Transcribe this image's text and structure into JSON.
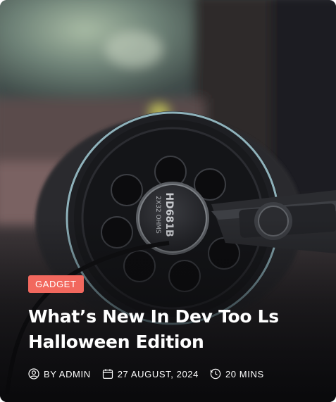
{
  "post": {
    "category": "GADGET",
    "title": "What’s New In Dev Too Ls Halloween Edition",
    "author": "BY ADMIN",
    "date": "27 AUGUST, 2024",
    "read_time": "20 MINS"
  },
  "image": {
    "subject": "over-ear studio headphones",
    "printed_text": [
      "HD681B",
      "2X32 OHMS"
    ]
  },
  "icons": {
    "author": "user-circle-icon",
    "date": "calendar-icon",
    "read_time": "clock-icon"
  },
  "colors": {
    "badge": "#f2685e",
    "text": "#ffffff",
    "overlay": "#0a0a0c"
  }
}
